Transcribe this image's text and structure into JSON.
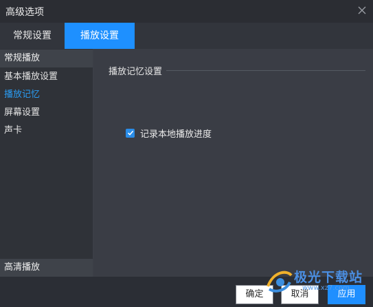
{
  "window": {
    "title": "高级选项"
  },
  "tabs": [
    {
      "label": "常规设置"
    },
    {
      "label": "播放设置"
    }
  ],
  "sidebar": {
    "header": "常规播放",
    "items": [
      {
        "label": "基本播放设置"
      },
      {
        "label": "播放记忆"
      },
      {
        "label": "屏幕设置"
      },
      {
        "label": "声卡"
      }
    ],
    "footer_header": "高清播放"
  },
  "panel": {
    "group_title": "播放记忆设置",
    "checkbox_label": "记录本地播放进度",
    "checkbox_checked": true
  },
  "buttons": {
    "ok": "确定",
    "cancel": "取消",
    "apply": "应用"
  },
  "watermark": {
    "text": "极光下载站",
    "url": "www.xz7.com"
  },
  "colors": {
    "accent": "#1e90ff",
    "active_item": "#2a9df4"
  }
}
